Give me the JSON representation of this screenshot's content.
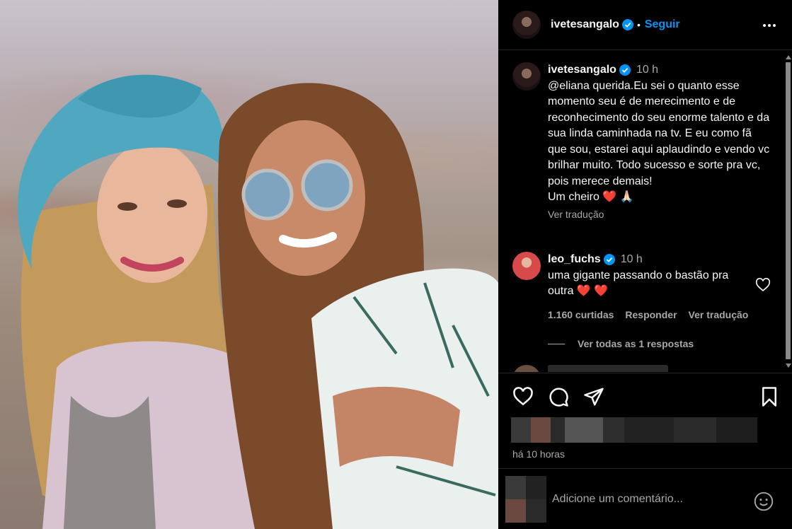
{
  "post": {
    "author": "ivetesangalo",
    "separator": "•",
    "follow_label": "Seguir",
    "time_ago": "há 10 horas",
    "add_comment_placeholder": "Adicione um comentário..."
  },
  "caption": {
    "username": "ivetesangalo",
    "time": "10 h",
    "text": "@eliana querida.Eu sei o quanto esse momento seu é de merecimento e de reconhecimento do seu enorme talento e da sua linda caminhada na tv. E eu como fã que sou, estarei aqui aplaudindo e vendo vc brilhar muito. Todo sucesso e sorte pra vc, pois merece demais!",
    "closing": "Um cheiro ❤️ 🙏🏻",
    "translate_label": "Ver tradução"
  },
  "comment": {
    "username": "leo_fuchs",
    "time": "10 h",
    "text": "uma gigante passando o bastão pra outra ❤️ ❤️",
    "likes": "1.160 curtidas",
    "reply_label": "Responder",
    "translate_label": "Ver tradução",
    "view_replies": "Ver todas as 1 respostas"
  },
  "icons": {
    "like": "heart-icon",
    "comment": "comment-icon",
    "share": "send-icon",
    "save": "bookmark-icon",
    "more": "more-icon",
    "verified": "verified-badge-icon",
    "emoji": "emoji-icon"
  },
  "colors": {
    "background": "#000000",
    "accent": "#0095f6",
    "muted_text": "#a8a8a8",
    "text": "#f5f5f5",
    "verified": "#0095f6"
  }
}
